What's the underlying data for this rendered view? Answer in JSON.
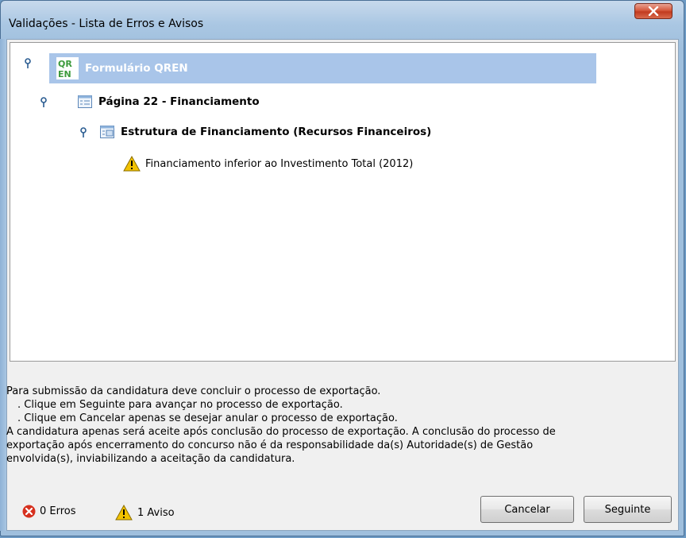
{
  "window": {
    "title": "Validações - Lista de Erros e Avisos",
    "close_label": "X"
  },
  "tree": {
    "root": {
      "label": "Formulário QREN",
      "logo_text": "QREN"
    },
    "page": {
      "label": "Página 22 - Financiamento"
    },
    "section": {
      "label": "Estrutura de Financiamento (Recursos Financeiros)"
    },
    "warning": {
      "label": "Financiamento inferior ao Investimento Total (2012)"
    }
  },
  "info": {
    "line1": "Para submissão da candidatura deve concluir o processo de exportação.",
    "line2": ". Clique em Seguinte para avançar no processo de exportação.",
    "line3": ". Clique em Cancelar apenas se desejar anular o processo de exportação.",
    "line4": "A candidatura apenas será aceite após conclusão do processo de exportação. A conclusão do processo de",
    "line5": "exportação após encerramento do concurso não é da responsabilidade da(s) Autoridade(s) de Gestão",
    "line6": "envolvida(s), inviabilizando a aceitação da candidatura."
  },
  "status": {
    "errors": "0 Erros",
    "warnings": "1 Aviso"
  },
  "buttons": {
    "cancel": "Cancelar",
    "next": "Seguinte"
  },
  "colors": {
    "selection": "#a9c5e9",
    "error": "#d6301e",
    "warning": "#f2c200",
    "title_bar": "#aac7e3"
  },
  "icons": {
    "pin": "pin-icon",
    "page": "page-icon",
    "warning": "warning-icon",
    "error": "error-icon",
    "logo": "qren-logo"
  }
}
